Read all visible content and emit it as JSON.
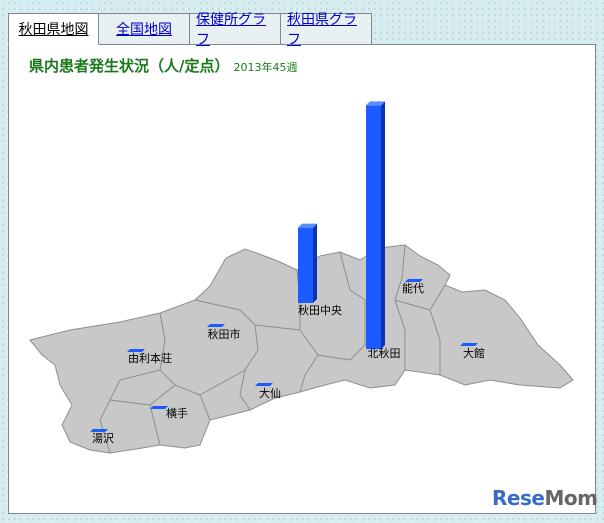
{
  "tabs": [
    {
      "label": "秋田県地図",
      "active": true
    },
    {
      "label": "全国地図",
      "active": false
    },
    {
      "label": "保健所グラフ",
      "active": false
    },
    {
      "label": "秋田県グラフ",
      "active": false
    }
  ],
  "title": "県内患者発生状況（人/定点）",
  "subtitle": "2013年45週",
  "chart_data": {
    "type": "bar",
    "categories": [
      "能代",
      "秋田中央",
      "秋田市",
      "北秋田",
      "大館",
      "由利本荘",
      "大仙",
      "横手",
      "湯沢"
    ],
    "values": [
      0,
      1.3,
      0,
      4.2,
      0,
      0,
      0,
      0,
      0
    ]
  },
  "colors": {
    "bar": "#1a5cff",
    "bar_side": "#0b34b0",
    "region": "#c8c8c8",
    "border": "#8e8e8e",
    "title": "#1a7a1a"
  },
  "watermark": {
    "left": "Rese",
    "right": "Mom"
  }
}
